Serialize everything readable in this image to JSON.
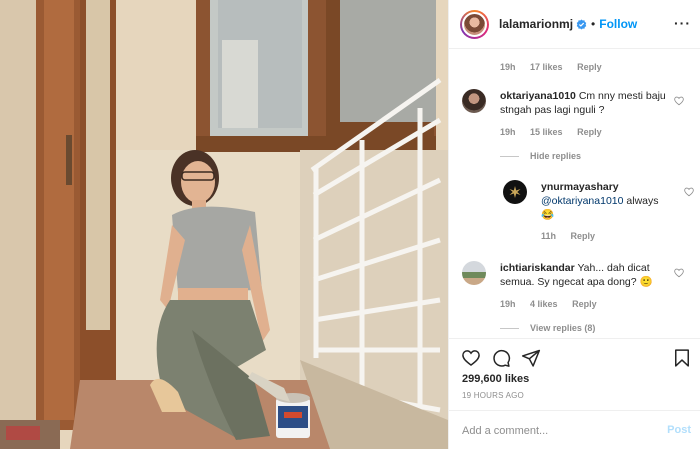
{
  "post": {
    "username": "lalamarionmj",
    "follow_label": "Follow",
    "separator": "•"
  },
  "comments": {
    "top_meta": {
      "time": "19h",
      "likes": "17 likes",
      "reply": "Reply"
    },
    "items": [
      {
        "username": "oktariyana1010",
        "text": "Cm nny mesti baju stngah pas lagi nguli ?",
        "time": "19h",
        "likes": "15 likes",
        "reply": "Reply"
      },
      {
        "username": "ichtiariskandar",
        "text": "Yah... dah dicat semua. Sy ngecat apa dong? 🙂",
        "time": "19h",
        "likes": "4 likes",
        "reply": "Reply"
      }
    ],
    "hide_replies_label": "Hide replies",
    "nested_reply": {
      "username": "ynurmayashary",
      "mention": "@oktariyana1010",
      "text": "always",
      "emoji": "😂",
      "time": "11h",
      "reply": "Reply"
    },
    "view_replies_label": "View replies (8)"
  },
  "engagement": {
    "likes": "299,600 likes",
    "time_ago": "19 HOURS AGO"
  },
  "add_comment": {
    "placeholder": "Add a comment...",
    "post_label": "Post"
  },
  "icons": {
    "like": "heart-icon",
    "comment": "comment-icon",
    "share": "share-icon",
    "save": "bookmark-icon",
    "verified": "verified-badge-icon",
    "more": "more-options-icon"
  },
  "colors": {
    "link_blue": "#0095f6",
    "muted_text": "#8e8e8e",
    "border": "#efefef",
    "post_disabled": "#b2dffc"
  }
}
